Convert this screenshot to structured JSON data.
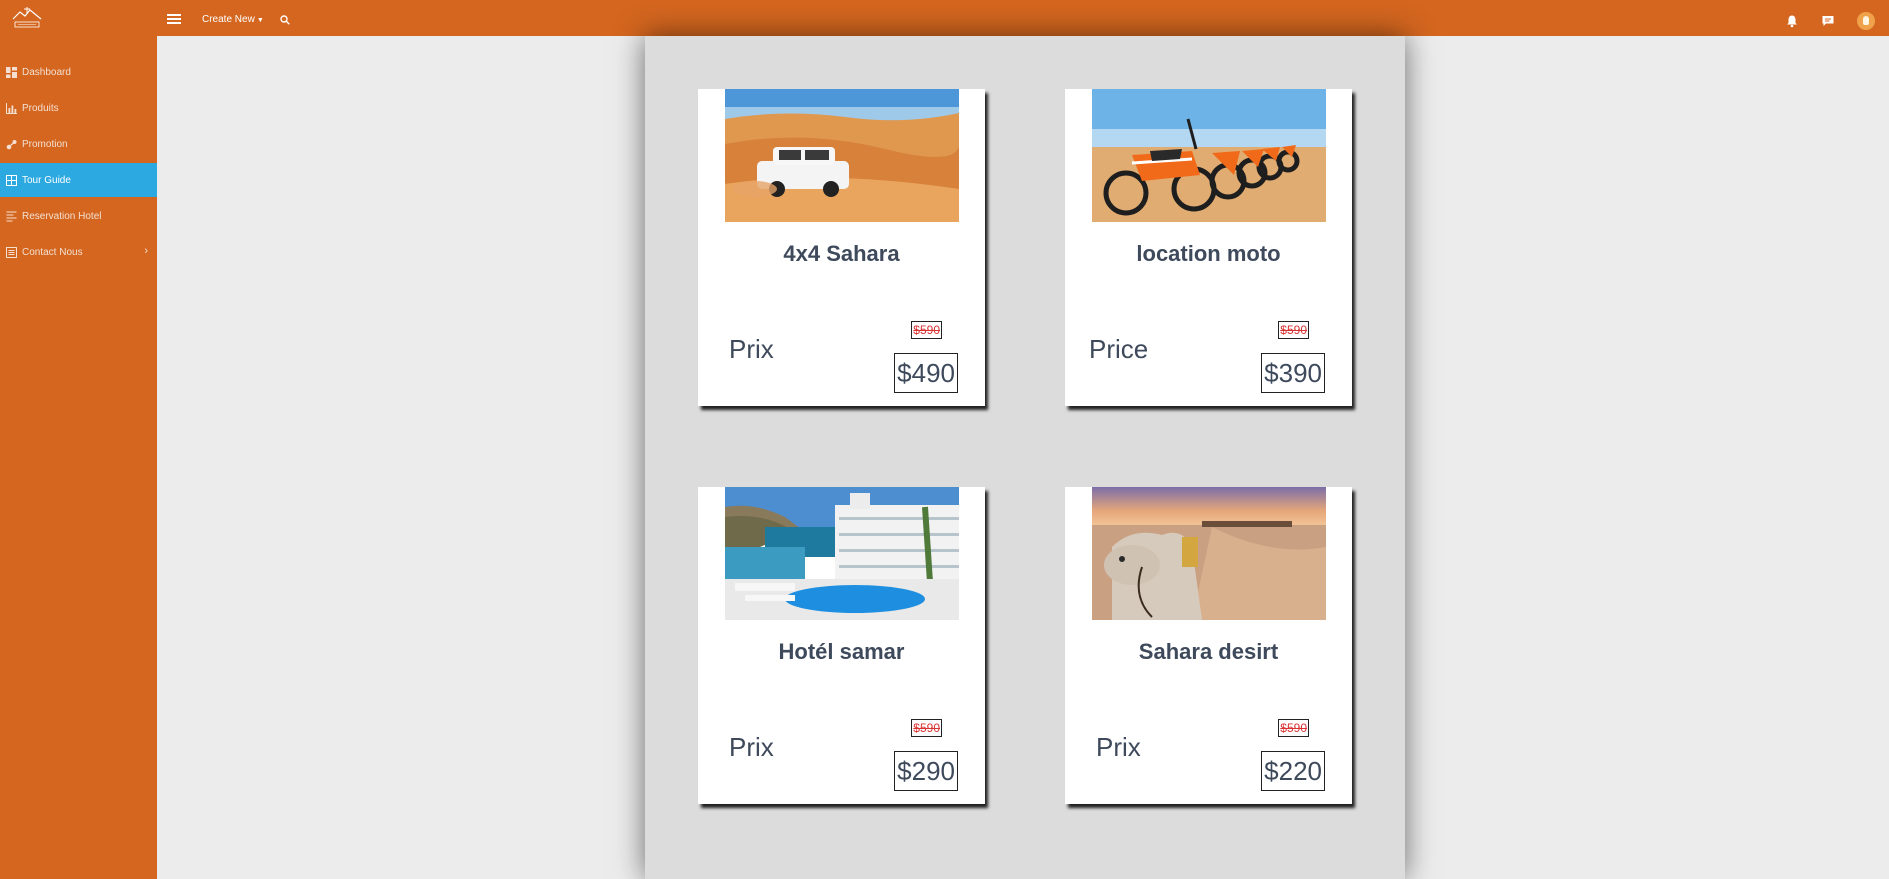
{
  "header": {
    "create_new_label": "Create New",
    "icons": [
      "menu-icon",
      "search-icon",
      "bell-icon",
      "chat-icon",
      "avatar"
    ]
  },
  "sidebar": {
    "items": [
      {
        "label": "Dashboard",
        "icon": "dashboard-icon",
        "active": false
      },
      {
        "label": "Produits",
        "icon": "bar-chart-icon",
        "active": false
      },
      {
        "label": "Promotion",
        "icon": "promotion-icon",
        "active": false
      },
      {
        "label": "Tour Guide",
        "icon": "grid-icon",
        "active": true
      },
      {
        "label": "Reservation Hotel",
        "icon": "list-icon",
        "active": false
      },
      {
        "label": "Contact Nous",
        "icon": "contact-icon",
        "active": false,
        "has_submenu": true
      }
    ]
  },
  "cards": [
    {
      "title": "4x4 Sahara",
      "price_label": "Prix",
      "old_price": "$590",
      "new_price": "$490",
      "image": "desert-4x4-photo"
    },
    {
      "title": "location moto",
      "price_label": "Price",
      "old_price": "$590",
      "new_price": "$390",
      "image": "motorbikes-photo"
    },
    {
      "title": "Hotél samar",
      "price_label": "Prix",
      "old_price": "$590",
      "new_price": "$290",
      "image": "hotel-pool-photo"
    },
    {
      "title": "Sahara desirt",
      "price_label": "Prix",
      "old_price": "$590",
      "new_price": "$220",
      "image": "camel-desert-photo"
    }
  ],
  "colors": {
    "brand": "#d4661f",
    "active": "#2da9e1",
    "text": "#3e4a5c",
    "strike": "#d83232"
  }
}
